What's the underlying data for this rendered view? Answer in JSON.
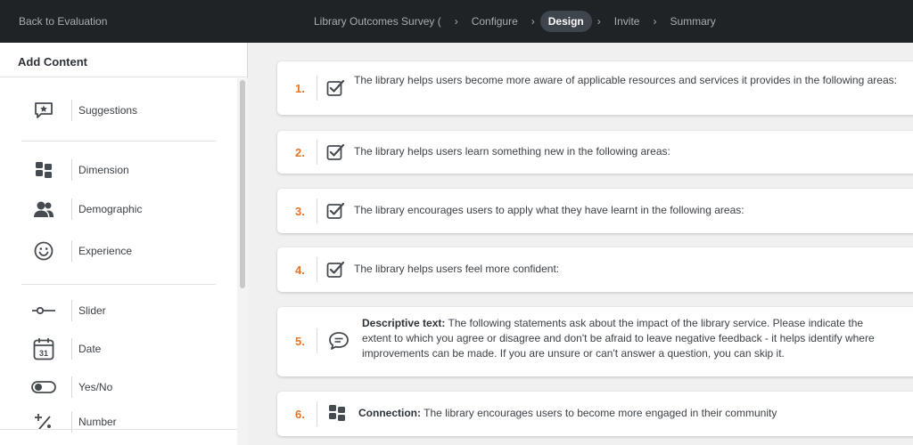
{
  "header": {
    "back_label": "Back to Evaluation",
    "breadcrumbs": [
      {
        "label": "Library Outcomes Survey ("
      },
      {
        "label": "Configure"
      },
      {
        "label": "Design"
      },
      {
        "label": "Invite"
      },
      {
        "label": "Summary"
      }
    ],
    "active_step": "Design",
    "separator": "›"
  },
  "sidebar": {
    "title": "Add Content",
    "items": [
      {
        "label": "Suggestions",
        "icon": "star-comment-icon"
      },
      {
        "label": "Dimension",
        "icon": "grid-blocks-icon"
      },
      {
        "label": "Demographic",
        "icon": "users-icon"
      },
      {
        "label": "Experience",
        "icon": "smiley-icon"
      },
      {
        "label": "Slider",
        "icon": "slider-icon"
      },
      {
        "label": "Date",
        "icon": "calendar-icon"
      },
      {
        "label": "Yes/No",
        "icon": "toggle-icon"
      },
      {
        "label": "Number",
        "icon": "plus-percent-icon"
      }
    ],
    "calendar_day": "31"
  },
  "questions": [
    {
      "number": "1.",
      "icon": "checkbox-icon",
      "prefix": "",
      "text": "The library helps users become more aware of applicable resources and services it provides in the following areas:"
    },
    {
      "number": "2.",
      "icon": "checkbox-icon",
      "prefix": "",
      "text": "The library helps users learn something new in the following areas:"
    },
    {
      "number": "3.",
      "icon": "checkbox-icon",
      "prefix": "",
      "text": "The library encourages users to apply what they have learnt in the following areas:"
    },
    {
      "number": "4.",
      "icon": "checkbox-icon",
      "prefix": "",
      "text": "The library helps users feel more confident:"
    },
    {
      "number": "5.",
      "icon": "speech-bubble-icon",
      "prefix": "Descriptive text:",
      "text": " The following statements ask about the impact of the library service. Please indicate the extent to which you agree or disagree and don't be afraid to leave negative feedback - it helps identify where improvements can be made. If you are unsure or can't answer a question, you can skip it."
    },
    {
      "number": "6.",
      "icon": "grid-blocks-icon",
      "prefix": "Connection:",
      "text": " The library encourages users to become more engaged in their community"
    }
  ],
  "colors": {
    "topbar": "#1f2326",
    "active_pill": "#3e454c",
    "number_accent": "#e3742b",
    "icon": "#454b50"
  }
}
